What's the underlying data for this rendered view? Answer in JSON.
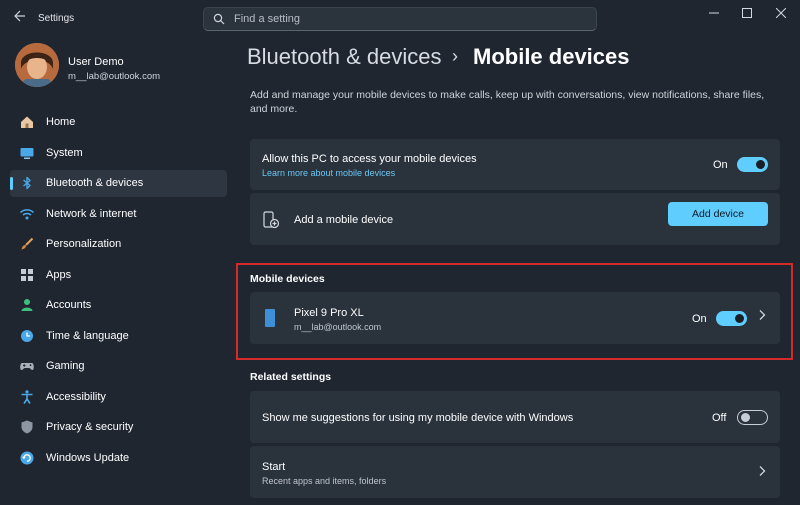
{
  "window": {
    "app_title": "Settings"
  },
  "search": {
    "placeholder": "Find a setting"
  },
  "profile": {
    "name": "User Demo",
    "email": "m__lab@outlook.com"
  },
  "nav": {
    "items": [
      {
        "label": "Home",
        "icon": "home-icon"
      },
      {
        "label": "System",
        "icon": "monitor-icon"
      },
      {
        "label": "Bluetooth & devices",
        "icon": "bluetooth-icon",
        "active": true
      },
      {
        "label": "Network & internet",
        "icon": "wifi-icon"
      },
      {
        "label": "Personalization",
        "icon": "brush-icon"
      },
      {
        "label": "Apps",
        "icon": "apps-grid-icon"
      },
      {
        "label": "Accounts",
        "icon": "person-icon"
      },
      {
        "label": "Time & language",
        "icon": "globe-clock-icon"
      },
      {
        "label": "Gaming",
        "icon": "gamepad-icon"
      },
      {
        "label": "Accessibility",
        "icon": "accessibility-icon"
      },
      {
        "label": "Privacy & security",
        "icon": "shield-icon"
      },
      {
        "label": "Windows Update",
        "icon": "update-icon"
      }
    ]
  },
  "breadcrumb": {
    "parent": "Bluetooth & devices",
    "separator": "›",
    "current": "Mobile devices"
  },
  "description": "Add and manage your mobile devices to make calls, keep up with conversations, view notifications, share files, and more.",
  "allow_access": {
    "title": "Allow this PC to access your mobile devices",
    "link": "Learn more about mobile devices",
    "state_label": "On",
    "enabled": true
  },
  "add_device": {
    "title": "Add a mobile device",
    "button_label": "Add device",
    "icon": "phone-add-icon"
  },
  "mobile_devices": {
    "section_title": "Mobile devices",
    "items": [
      {
        "name": "Pixel 9 Pro XL",
        "account": "m__lab@outlook.com",
        "state_label": "On",
        "enabled": true,
        "icon": "phone-icon"
      }
    ]
  },
  "related_settings": {
    "section_title": "Related settings",
    "suggestions": {
      "title": "Show me suggestions for using my mobile device with Windows",
      "state_label": "Off",
      "enabled": false
    },
    "start": {
      "title": "Start",
      "subtitle": "Recent apps and items, folders"
    }
  },
  "colors": {
    "accent": "#60cdff",
    "highlight_border": "#d42a2a",
    "background": "#1f2630",
    "card": "#2a323c"
  }
}
